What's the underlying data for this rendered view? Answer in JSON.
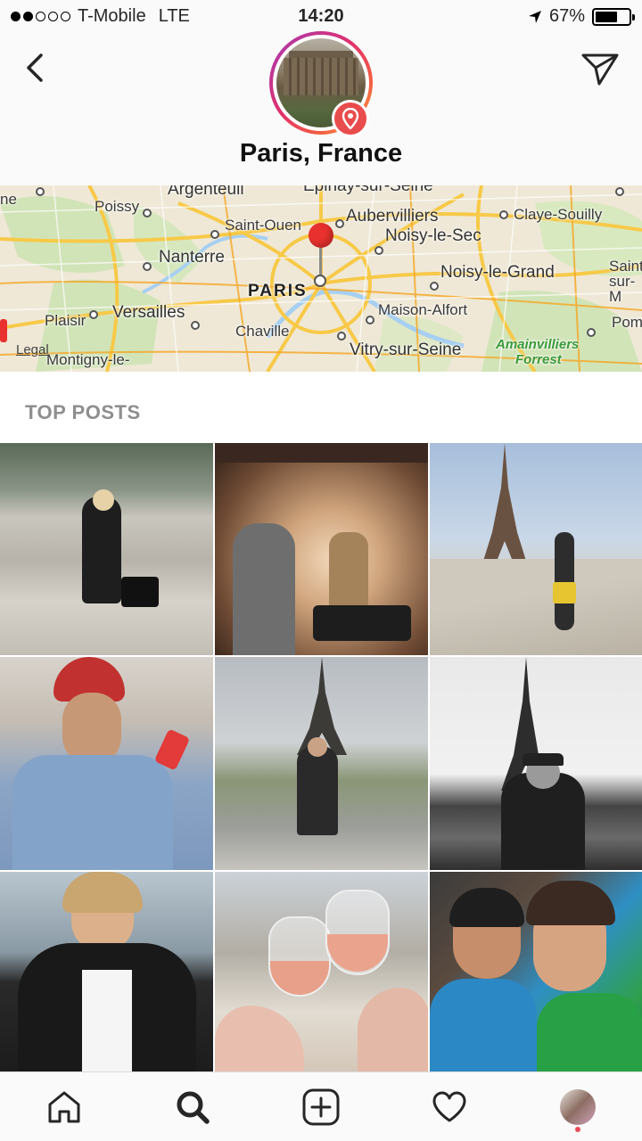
{
  "status_bar": {
    "carrier": "T-Mobile",
    "network": "LTE",
    "time": "14:20",
    "battery": "67%",
    "battery_level": 0.67
  },
  "header": {
    "title": "Paris, France"
  },
  "map": {
    "labels": {
      "argenteuil": "Argenteuil",
      "epinay": "Epinay-sur-Seine",
      "poissy": "Poissy",
      "saint_ouen": "Saint-Ouen",
      "aubervilliers": "Aubervilliers",
      "claye": "Claye-Souilly",
      "nanterre": "Nanterre",
      "noisy_le_sec": "Noisy-le-Sec",
      "noisy_le_grand": "Noisy-le-Grand",
      "saint_sur": "Saint sur-M",
      "paris": "PARIS",
      "plaisir": "Plaisir",
      "versailles": "Versailles",
      "maison_alfort": "Maison-Alfort",
      "pom": "Pom",
      "chaville": "Chaville",
      "montigny": "Montigny-le-",
      "vitry": "Vitry-sur-Seine",
      "amainvilliers": "Amainvilliers",
      "forrest": "Forrest",
      "ne": "ne"
    },
    "legal": "Legal"
  },
  "section": {
    "title": "TOP POSTS"
  },
  "posts": [
    {
      "id": "post-1"
    },
    {
      "id": "post-2"
    },
    {
      "id": "post-3"
    },
    {
      "id": "post-4"
    },
    {
      "id": "post-5"
    },
    {
      "id": "post-6"
    },
    {
      "id": "post-7"
    },
    {
      "id": "post-8"
    },
    {
      "id": "post-9"
    }
  ],
  "bottom_nav": {
    "items": [
      "home-icon",
      "search-icon",
      "add-icon",
      "heart-icon",
      "profile-avatar"
    ],
    "active": "search-icon"
  },
  "colors": {
    "accent_red": "#e94c4c",
    "pin_red": "#e8312e",
    "muted_text": "#8e8e8e",
    "notification": "#ed4956"
  }
}
